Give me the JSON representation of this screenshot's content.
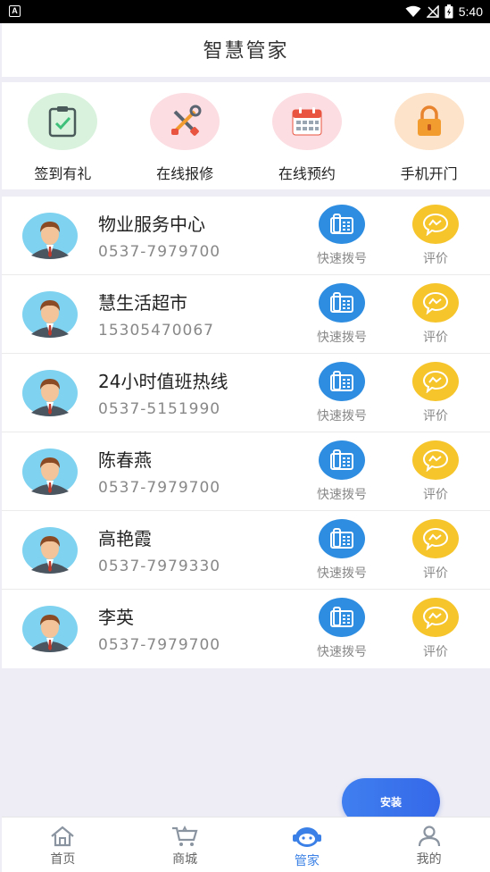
{
  "status_bar": {
    "notification_icon": "A",
    "time": "5:40",
    "icons": [
      "wifi-icon",
      "no-signal-icon",
      "battery-icon"
    ]
  },
  "header": {
    "title": "智慧管家"
  },
  "quick_actions": [
    {
      "label": "签到有礼",
      "icon": "clipboard-check-icon",
      "bg": "#d9f2dd"
    },
    {
      "label": "在线报修",
      "icon": "tools-icon",
      "bg": "#fbdde2"
    },
    {
      "label": "在线预约",
      "icon": "calendar-icon",
      "bg": "#fbdde2"
    },
    {
      "label": "手机开门",
      "icon": "lock-icon",
      "bg": "#fde3c9"
    }
  ],
  "contacts": [
    {
      "name": "物业服务中心",
      "phone": "0537-7979700",
      "dial_label": "快速拨号",
      "rate_label": "评价"
    },
    {
      "name": "慧生活超市",
      "phone": "15305470067",
      "dial_label": "快速拨号",
      "rate_label": "评价"
    },
    {
      "name": "24小时值班热线",
      "phone": "0537-5151990",
      "dial_label": "快速拨号",
      "rate_label": "评价"
    },
    {
      "name": "陈春燕",
      "phone": "0537-7979700",
      "dial_label": "快速拨号",
      "rate_label": "评价"
    },
    {
      "name": "高艳霞",
      "phone": "0537-7979330",
      "dial_label": "快速拨号",
      "rate_label": "评价"
    },
    {
      "name": "李英",
      "phone": "0537-7979700",
      "dial_label": "快速拨号",
      "rate_label": "评价"
    }
  ],
  "install_button": {
    "label": "安装"
  },
  "tabs": [
    {
      "label": "首页",
      "icon": "home-icon",
      "active": false
    },
    {
      "label": "商城",
      "icon": "cart-icon",
      "active": false
    },
    {
      "label": "管家",
      "icon": "butler-icon",
      "active": true
    },
    {
      "label": "我的",
      "icon": "user-icon",
      "active": false
    }
  ],
  "colors": {
    "accent": "#3a80e6",
    "dial": "#2e8de0",
    "rate": "#f6c52c",
    "page_bg": "#eeedf5"
  }
}
